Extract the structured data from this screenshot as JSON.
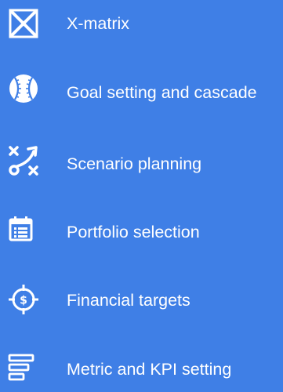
{
  "menu": {
    "items": [
      {
        "label": "X-matrix",
        "icon": "x-matrix-icon"
      },
      {
        "label": "Goal setting and cascade",
        "icon": "baseball-icon"
      },
      {
        "label": "Scenario planning",
        "icon": "strategy-play-icon"
      },
      {
        "label": "Portfolio selection",
        "icon": "calendar-list-icon"
      },
      {
        "label": "Financial targets",
        "icon": "dollar-target-icon"
      },
      {
        "label": "Metric and KPI setting",
        "icon": "tiered-bars-icon"
      }
    ]
  },
  "colors": {
    "background": "#3f7fe6",
    "foreground": "#ffffff"
  }
}
